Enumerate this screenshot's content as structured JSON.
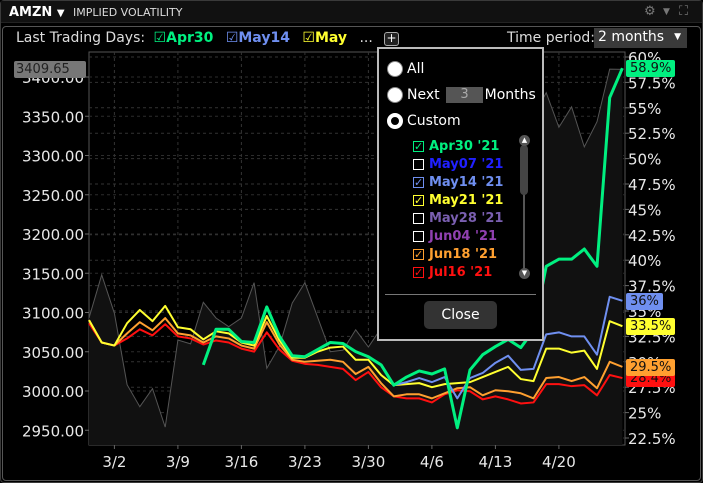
{
  "header": {
    "symbol": "AMZN",
    "title": "IMPLIED VOLATILITY",
    "icons": [
      "settings-icon",
      "chevron-down-icon",
      "maximize-icon"
    ]
  },
  "toolbar": {
    "label": "Last Trading Days:",
    "selected": [
      {
        "label": "Apr30",
        "color": "#00f080"
      },
      {
        "label": "May14",
        "color": "#6f8ff0"
      },
      {
        "label": "May",
        "color": "#ffff30"
      }
    ],
    "more": "...",
    "plus": "+",
    "time_period_label": "Time period:",
    "time_period_value": "2 months"
  },
  "popup": {
    "all": "All",
    "next": "Next",
    "next_value": "3",
    "months": "Months",
    "custom": "Custom",
    "selected_mode": "custom",
    "items": [
      {
        "label": "Apr30 '21",
        "color": "#00f080",
        "checked": true
      },
      {
        "label": "May07 '21",
        "color": "#2020ff",
        "checked": false
      },
      {
        "label": "May14 '21",
        "color": "#6f8ff0",
        "checked": true
      },
      {
        "label": "May21 '21",
        "color": "#ffff30",
        "checked": true
      },
      {
        "label": "May28 '21",
        "color": "#7a5fb0",
        "checked": false
      },
      {
        "label": "Jun04 '21",
        "color": "#9040b0",
        "checked": false
      },
      {
        "label": "Jun18 '21",
        "color": "#ffa030",
        "checked": true
      },
      {
        "label": "Jul16 '21",
        "color": "#ff1010",
        "checked": true
      }
    ],
    "close": "Close"
  },
  "chart_data": {
    "type": "line",
    "x": [
      "2/26",
      "3/1",
      "3/2",
      "3/3",
      "3/4",
      "3/5",
      "3/8",
      "3/9",
      "3/10",
      "3/11",
      "3/12",
      "3/15",
      "3/16",
      "3/17",
      "3/18",
      "3/19",
      "3/22",
      "3/23",
      "3/24",
      "3/25",
      "3/26",
      "3/29",
      "3/30",
      "3/31",
      "4/1",
      "4/2",
      "4/5",
      "4/6",
      "4/7",
      "4/8",
      "4/9",
      "4/12",
      "4/13",
      "4/14",
      "4/15",
      "4/16",
      "4/19",
      "4/20",
      "4/21",
      "4/22",
      "4/23",
      "4/26",
      "4/27"
    ],
    "x_ticks": [
      "3/2",
      "3/9",
      "3/16",
      "3/23",
      "3/30",
      "4/6",
      "4/13",
      "4/20"
    ],
    "y_left_ticks": [
      "3400.00",
      "3350.00",
      "3300.00",
      "3250.00",
      "3200.00",
      "3150.00",
      "3100.00",
      "3050.00",
      "3000.00",
      "2950.00"
    ],
    "y_left_range": [
      2950,
      3400
    ],
    "y_right_ticks": [
      "60%",
      "57.5%",
      "55%",
      "52.5%",
      "50%",
      "47.5%",
      "45%",
      "42.5%",
      "40%",
      "37.5%",
      "35%",
      "32.5%",
      "30%",
      "27.5%",
      "25%",
      "22.5%"
    ],
    "y_right_range": [
      22.5,
      60
    ],
    "grid": true,
    "price": {
      "last_label": "3409.65",
      "color": "#555555",
      "values": [
        3093,
        3148,
        3099,
        3008,
        2980,
        3003,
        2954,
        3065,
        3060,
        3113,
        3093,
        3082,
        3093,
        3138,
        3029,
        3057,
        3112,
        3138,
        3094,
        3050,
        3052,
        3078,
        3056,
        3080,
        3090,
        3100,
        3120,
        3140,
        3170,
        3190,
        3220,
        3250,
        3280,
        3300,
        3330,
        3350,
        3380,
        3336,
        3362,
        3311,
        3343,
        3410,
        3409.65
      ]
    },
    "series": [
      {
        "name": "Jul16 '21",
        "color": "#ff1010",
        "end_label": "28.4%",
        "values": [
          33.8,
          31.9,
          31.6,
          32.3,
          33.2,
          32.6,
          33.7,
          32.5,
          32.3,
          31.7,
          32.1,
          31.9,
          31.3,
          31.0,
          32.9,
          31.2,
          30.1,
          29.8,
          29.7,
          29.5,
          29.3,
          28.2,
          29.0,
          27.5,
          26.6,
          26.4,
          26.4,
          26.0,
          26.8,
          27.2,
          27.1,
          26.3,
          26.6,
          26.3,
          25.9,
          26.0,
          27.8,
          27.8,
          27.6,
          27.7,
          26.7,
          28.7,
          28.4
        ]
      },
      {
        "name": "Jun18 '21",
        "color": "#ffa030",
        "end_label": "29.5%",
        "values": [
          34.1,
          31.9,
          31.6,
          32.8,
          33.9,
          33.1,
          34.3,
          32.8,
          32.6,
          31.9,
          32.5,
          32.3,
          31.6,
          31.3,
          33.9,
          31.7,
          30.2,
          30.0,
          30.1,
          30.2,
          30.0,
          28.8,
          29.5,
          27.9,
          26.6,
          26.8,
          26.8,
          26.4,
          26.9,
          27.4,
          27.5,
          26.7,
          27.2,
          27.1,
          26.9,
          26.4,
          28.4,
          28.5,
          28.1,
          28.5,
          27.4,
          30.0,
          29.5
        ]
      },
      {
        "name": "May21 '21",
        "color": "#ffff30",
        "end_label": "33.5%",
        "values": [
          34.1,
          31.9,
          31.6,
          33.8,
          35.1,
          34.0,
          35.5,
          33.4,
          33.2,
          32.2,
          33.0,
          32.8,
          31.9,
          31.6,
          34.5,
          32.1,
          30.4,
          30.4,
          31.0,
          31.4,
          31.5,
          30.2,
          30.2,
          28.7,
          27.7,
          27.8,
          27.9,
          27.5,
          27.8,
          27.9,
          28.0,
          28.5,
          29.0,
          29.5,
          28.3,
          28.1,
          31.3,
          31.3,
          30.9,
          31.1,
          29.3,
          34.0,
          33.5
        ]
      },
      {
        "name": "May14 '21",
        "color": "#6f8ff0",
        "end_label": "36%",
        "values": [
          null,
          null,
          null,
          null,
          null,
          null,
          null,
          null,
          null,
          null,
          null,
          null,
          null,
          null,
          null,
          null,
          null,
          null,
          null,
          null,
          null,
          null,
          null,
          null,
          27.7,
          28.0,
          28.4,
          28.0,
          28.5,
          26.4,
          28.4,
          28.9,
          29.9,
          30.6,
          29.2,
          29.3,
          32.7,
          32.9,
          32.5,
          32.5,
          30.7,
          36.4,
          36.0
        ]
      },
      {
        "name": "Apr30 '21",
        "color": "#00f080",
        "end_label": "58.9%",
        "values": [
          null,
          null,
          null,
          null,
          null,
          null,
          null,
          null,
          null,
          29.7,
          33.2,
          33.2,
          32.0,
          31.9,
          35.4,
          32.5,
          30.6,
          30.5,
          31.2,
          31.9,
          31.8,
          31.0,
          30.5,
          29.7,
          27.7,
          28.5,
          29.1,
          28.8,
          29.3,
          23.5,
          29.2,
          30.7,
          31.5,
          32.2,
          31.4,
          33.1,
          39.4,
          40.1,
          40.1,
          41.1,
          39.4,
          56.0,
          58.9
        ]
      }
    ]
  }
}
